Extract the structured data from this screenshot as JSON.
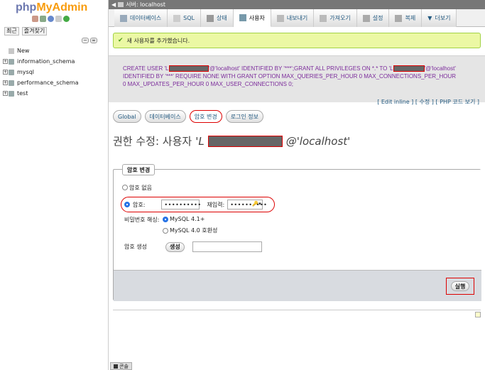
{
  "left": {
    "logo_php": "php",
    "logo_admin": "MyAdmin",
    "links": [
      "최근",
      "즐겨찾기"
    ],
    "tree": [
      {
        "label": "New",
        "type": "new"
      },
      {
        "label": "information_schema",
        "type": "db"
      },
      {
        "label": "mysql",
        "type": "db"
      },
      {
        "label": "performance_schema",
        "type": "db"
      },
      {
        "label": "test",
        "type": "db"
      }
    ]
  },
  "server_bar": {
    "label": "서버: localhost"
  },
  "tabs": [
    {
      "label": "데이터베이스",
      "icon": "database-icon"
    },
    {
      "label": "SQL",
      "icon": "sql-icon"
    },
    {
      "label": "상태",
      "icon": "status-icon"
    },
    {
      "label": "사용자",
      "icon": "users-icon",
      "active": true
    },
    {
      "label": "내보내기",
      "icon": "export-icon"
    },
    {
      "label": "가져오기",
      "icon": "import-icon"
    },
    {
      "label": "설정",
      "icon": "settings-icon"
    },
    {
      "label": "복제",
      "icon": "replication-icon"
    },
    {
      "label": "더보기",
      "icon": "more-icon"
    }
  ],
  "success": {
    "message": "새 사용자를 추가했습니다."
  },
  "sql": {
    "line1_a": "CREATE USER 'L",
    "line1_b": "'@'localhost' IDENTIFIED BY '***';GRANT ALL PRIVILEGES ON *.* TO 'L",
    "line1_c": "'@'localhost'",
    "line2": "IDENTIFIED BY '***' REQUIRE NONE WITH GRANT OPTION MAX_QUERIES_PER_HOUR 0 MAX_CONNECTIONS_PER_HOUR",
    "line3": "0 MAX_UPDATES_PER_HOUR 0 MAX_USER_CONNECTIONS 0;",
    "edit_inline": "Edit inline",
    "edit": "수정",
    "php_code": "PHP 코드 보기"
  },
  "subtabs": [
    {
      "label": "Global"
    },
    {
      "label": "데이터베이스"
    },
    {
      "label": "암호 변경",
      "active": true
    },
    {
      "label": "로그인 정보"
    }
  ],
  "title": {
    "prefix": "권한 수정: 사용자 ",
    "user_start": "'L",
    "host": "@'localhost'"
  },
  "form": {
    "legend": "암호 변경",
    "no_password": "암호 없음",
    "password_label": "암호:",
    "password_value": "••••••••••",
    "reenter_label": "재입력:",
    "reenter_value": "••••••••••",
    "hash_label": "비밀번호 해싱:",
    "hash_opt1": "MySQL 4.1+",
    "hash_opt2": "MySQL 4.0 호환성",
    "generate_label": "암호 생성",
    "generate_button": "생성",
    "generated_value": "",
    "go_button": "실행"
  },
  "console": {
    "label": "콘솔"
  }
}
